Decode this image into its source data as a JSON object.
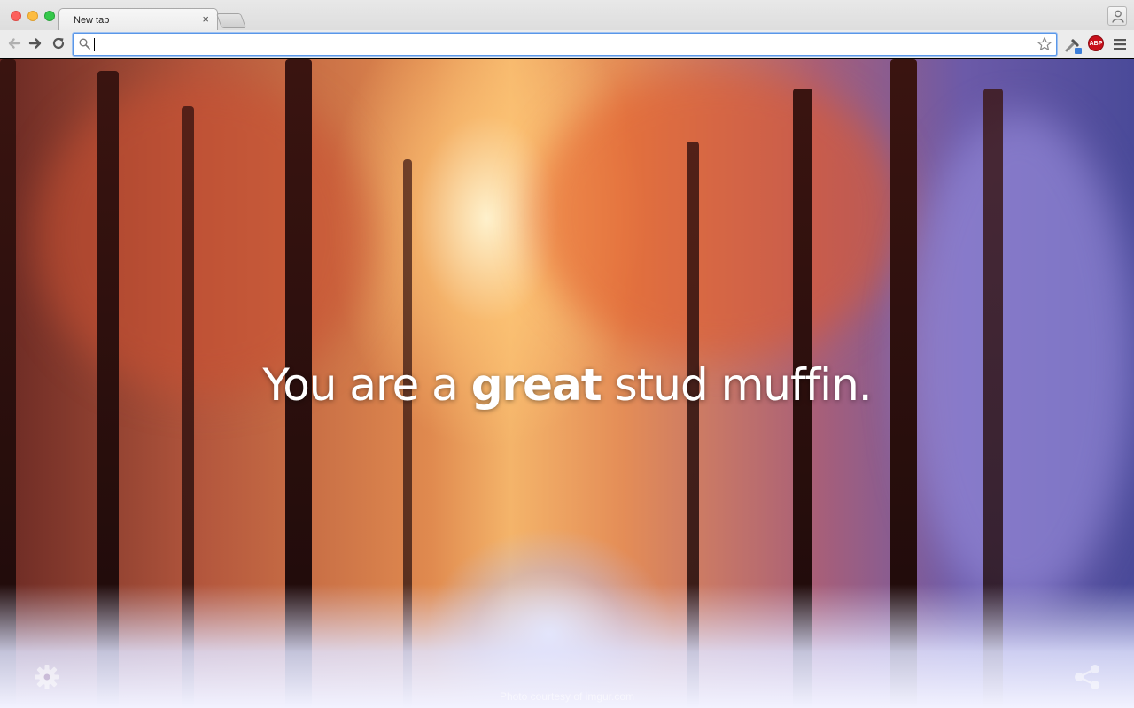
{
  "window": {
    "tab_title": "New tab",
    "tab_close_glyph": "×"
  },
  "toolbar": {
    "omnibox_value": "",
    "extensions": [
      {
        "name": "eyedropper-extension-icon"
      },
      {
        "name": "adblock-plus-icon",
        "label": "ABP"
      }
    ]
  },
  "page": {
    "motto_prefix": "You are a",
    "motto_emphasis": "great",
    "motto_suffix": "stud muffin.",
    "credit": "Photo courtesy of imgur.com"
  },
  "colors": {
    "accent_focus": "#5a97e8",
    "abp_red": "#c8101b"
  }
}
